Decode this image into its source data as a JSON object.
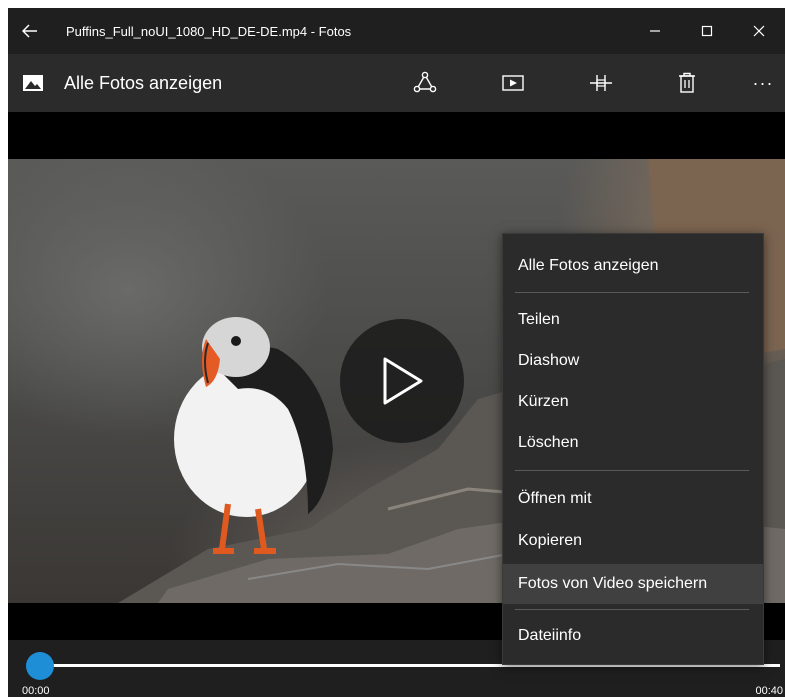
{
  "window": {
    "title": "Puffins_Full_noUI_1080_HD_DE-DE.mp4 - Fotos",
    "back_icon": "arrow-left-icon",
    "minimize_glyph": "—",
    "maximize_glyph": "☐",
    "close_glyph": "✕"
  },
  "toolbar": {
    "gallery_label": "Alle Fotos anzeigen",
    "more_glyph": "···"
  },
  "player": {
    "time_start": "00:00",
    "time_end": "00:40",
    "progress": 0.0,
    "accent_color": "#1e8fd6"
  },
  "context_menu": {
    "items": [
      {
        "label": "Alle Fotos anzeigen"
      },
      {
        "label": "Teilen"
      },
      {
        "label": "Diashow"
      },
      {
        "label": "Kürzen"
      },
      {
        "label": "Löschen"
      },
      {
        "label": "Öffnen mit"
      },
      {
        "label": "Kopieren"
      },
      {
        "label": "Fotos von Video speichern",
        "hovered": true
      },
      {
        "label": "Dateiinfo"
      }
    ]
  }
}
